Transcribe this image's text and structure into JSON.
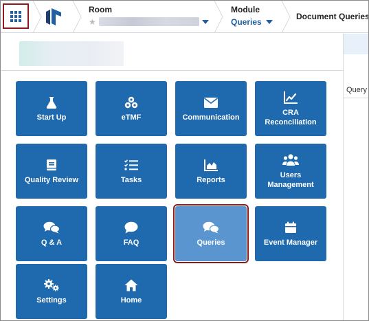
{
  "header": {
    "room_label": "Room",
    "module_label": "Module",
    "module_value": "Queries",
    "page_title": "Document Queries"
  },
  "background": {
    "column_header": "Query"
  },
  "colors": {
    "tile": "#1f6aaf",
    "tile_active": "#5b95cf",
    "highlight_border": "#8b1a1a",
    "accent": "#1f5fa3"
  },
  "apps": [
    {
      "label": "Start Up",
      "icon": "flask-icon"
    },
    {
      "label": "eTMF",
      "icon": "cubes-icon"
    },
    {
      "label": "Communication",
      "icon": "envelope-icon"
    },
    {
      "label": "CRA Reconciliation",
      "icon": "line-chart-icon"
    },
    {
      "label": "Quality Review",
      "icon": "book-icon"
    },
    {
      "label": "Tasks",
      "icon": "tasks-icon"
    },
    {
      "label": "Reports",
      "icon": "area-chart-icon"
    },
    {
      "label": "Users Management",
      "icon": "users-icon"
    },
    {
      "label": "Q & A",
      "icon": "chat-bubbles-icon"
    },
    {
      "label": "FAQ",
      "icon": "chat-bubble-icon"
    },
    {
      "label": "Queries",
      "icon": "chat-bubbles-icon",
      "selected": true
    },
    {
      "label": "Event Manager",
      "icon": "calendar-icon"
    },
    {
      "label": "Settings",
      "icon": "cogs-icon"
    },
    {
      "label": "Home",
      "icon": "home-icon"
    }
  ]
}
